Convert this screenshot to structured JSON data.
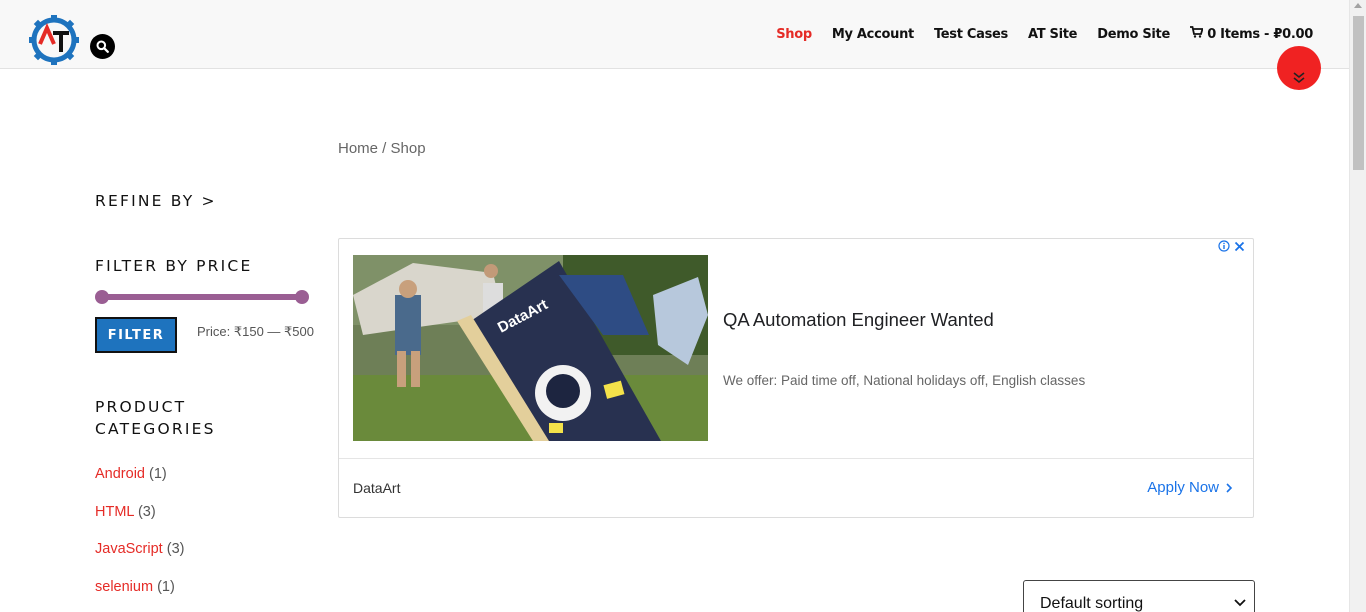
{
  "header": {
    "nav": [
      {
        "label": "Shop",
        "active": true
      },
      {
        "label": "My Account"
      },
      {
        "label": "Test Cases"
      },
      {
        "label": "AT Site"
      },
      {
        "label": "Demo Site"
      }
    ],
    "cart_label": "0 Items - ₽0.00"
  },
  "breadcrumb": {
    "home": "Home",
    "separator": " / ",
    "current": "Shop"
  },
  "sidebar": {
    "refine_heading": "REFINE BY >",
    "filter_price_heading": "FILTER BY PRICE",
    "filter_button": "FILTER",
    "price_label": "Price: ₹150 — ₹500",
    "categories_heading": "PRODUCT CATEGORIES",
    "categories": [
      {
        "name": "Android",
        "count": "(1)"
      },
      {
        "name": "HTML",
        "count": "(3)"
      },
      {
        "name": "JavaScript",
        "count": "(3)"
      },
      {
        "name": "selenium",
        "count": "(1)"
      }
    ]
  },
  "ad": {
    "image_brand": "DataArt",
    "title": "QA Automation Engineer Wanted",
    "description": "We offer: Paid time off, National holidays off, English classes",
    "advertiser": "DataArt",
    "cta": "Apply Now"
  },
  "sorting": {
    "selected": "Default sorting"
  },
  "colors": {
    "accent": "#e52b26",
    "button": "#1e73be",
    "slider": "#9a5e93",
    "fab": "#f02222",
    "ad_link": "#1a73e8"
  }
}
